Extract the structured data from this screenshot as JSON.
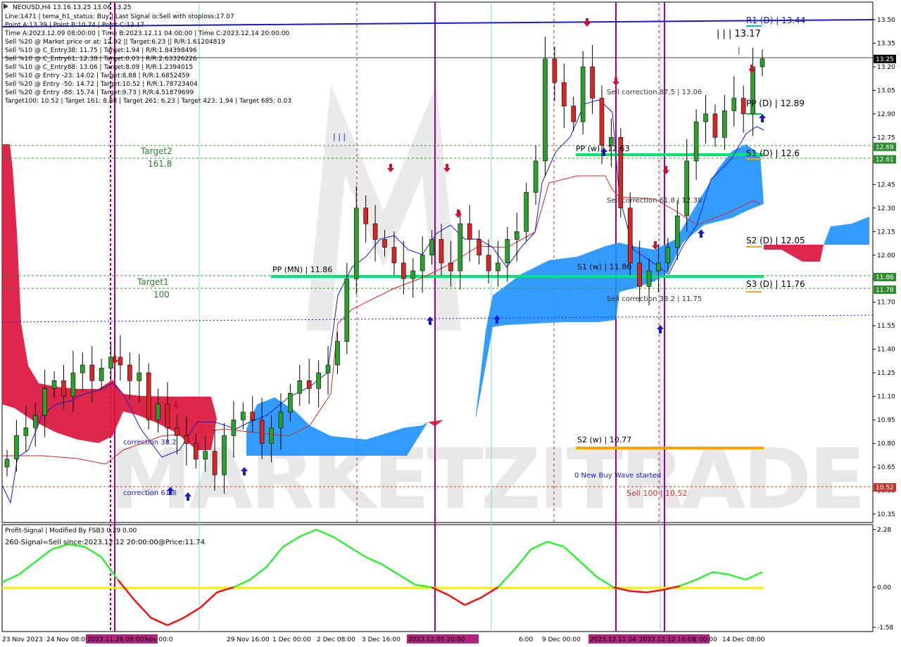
{
  "symbol": "NEOUSD,H4  13.16 13.25 13.06 13.25",
  "info_lines": [
    "Line:1471 | tema_h1_status: Buy | Last Signal is:Sell with stoploss:17.07",
    "Point A:13.39 | Point B:10.74 | Point C:12.17",
    "Time A:2023.12.09 08:00:00 | Time B:2023.12.11 04:00:00 | Time C:2023.12.14 20:00:00",
    "Sell %20 @ Market price or at: 12.92 || Target:6.23 || R/R:1.61204819",
    "Sell %10 @ C_Entry38: 11.75 | Target:1.94 | R/R:1.84398496",
    "Sell %10 @ C_Entry61: 12.38 | Target:0.03 | R/R:2.63326226",
    "Sell %10 @ C_Entry88: 13.06 | Target:8.09 | R/R:1.2394015",
    "Sell %10 @ Entry -23: 14.02 | Target:8.88 | R/R:1.6852459",
    "Sell %20 @ Entry -50: 14.72 | Target:10.52 | R/R:1.78723404",
    "Sell %20 @ Entry -88: 15.74 | Target:9.73 | R/R:4.51879699",
    "Target100: 10.52 | Target 161: 8.88 | Target 261: 6.23 | Target 423: 1.94 | Target 685: 0.03"
  ],
  "level_labels": {
    "r1_d": "R1 (D) | 13.44",
    "abc": "| | | 13.17",
    "pp_d": "PP (D) | 12.89",
    "s1_d": "S1 (D) | 12.6",
    "s2_d": "S2 (D) | 12.05",
    "s3_d": "S3 (D) | 11.76",
    "pp_w": "PP (w) | 12.63",
    "s1_w": "S1 (w) | 11.86",
    "s2_w": "S2 (w) | 10.77",
    "pp_mn": "PP (MN) | 11.86",
    "sell_corr_875": "Sell correction 87.5 | 13.06",
    "sell_corr_618": "Sell correction 61.8 | 12.38",
    "sell_corr_382": "Sell correction 38.2 | 11.75",
    "target2": "Target2",
    "target2_val": "161.8",
    "target1": "Target1",
    "target1_val": "100",
    "new_buy_wave": "0 New Buy Wave started",
    "sell_100": "Sell 100 | 10.52",
    "correction_382": "correction 38.2",
    "correction_618": "correction 61.8",
    "bars3_a": "| | |",
    "bars_b": "|",
    "bars_c": "| |"
  },
  "price_axis": {
    "ticks": [
      "13.50",
      "13.35",
      "13.20",
      "13.05",
      "12.90",
      "12.75",
      "12.60",
      "12.45",
      "12.30",
      "12.15",
      "12.00",
      "11.85",
      "11.70",
      "11.55",
      "11.40",
      "11.25",
      "11.10",
      "10.95",
      "10.80",
      "10.65",
      "10.50",
      "10.35"
    ],
    "badges": [
      {
        "text": "13.25",
        "bg": "#000000",
        "fg": "#ffffff"
      },
      {
        "text": "12.69",
        "bg": "#2e8b2e",
        "fg": "#ffffff"
      },
      {
        "text": "12.61",
        "bg": "#2e8b2e",
        "fg": "#ffffff"
      },
      {
        "text": "11.86",
        "bg": "#2e8b2e",
        "fg": "#ffffff"
      },
      {
        "text": "11.78",
        "bg": "#2e8b2e",
        "fg": "#ffffff"
      },
      {
        "text": "10.52",
        "bg": "#c0392b",
        "fg": "#ffffff"
      }
    ]
  },
  "time_axis": {
    "labels": [
      "23 Nov 2023",
      "24 Nov 08:00",
      "2023.11.26 08:00",
      "Nov 00:0",
      "29 Nov 16:00",
      "1 Dec 00:00",
      "2 Dec 08:00",
      "3 Dec 16:00",
      "2023.12.05 20:00",
      "6:00",
      "9 Dec 00:00",
      "2023.12.11 04",
      "2023.12.12 16:00",
      "c 00:00",
      "14 Dec 08:00"
    ],
    "highlighted": [
      "2023.11.26 08:00",
      "2023.12.05 20:00",
      "2023.12.11 04",
      "2023.12.12 16:00"
    ]
  },
  "indicator": {
    "title": "Profit-Signal | Modified By FSB3 0.29 0.00",
    "signal": "260-Signal=Sell since:2023.12.12 20:00:00@Price:11.74",
    "axis_ticks": [
      "2.28",
      "0.00",
      "-1.58"
    ]
  },
  "watermark": "MARKETZITRADE",
  "colors": {
    "bull": "#2ca02c",
    "bear": "#d62728",
    "cloud_bull": "#1e90ff",
    "cloud_bear": "#dc143c",
    "pivot": "#00e676",
    "s2w": "#ffa500",
    "r1": "#0000cc",
    "vline_magenta": "#a0008c",
    "vline_cyan": "#7fd4e0"
  },
  "chart_data": [
    {
      "type": "candlestick",
      "title": "NEOUSD,H4",
      "ylim": [
        10.31,
        13.54
      ],
      "last_ohlc": {
        "open": 13.16,
        "high": 13.25,
        "low": 13.06,
        "close": 13.25
      },
      "horizontal_levels": [
        {
          "name": "R1 (D)",
          "value": 13.44
        },
        {
          "name": "PP (D)",
          "value": 12.89
        },
        {
          "name": "S1 (D)",
          "value": 12.6
        },
        {
          "name": "S2 (D)",
          "value": 12.05
        },
        {
          "name": "S3 (D)",
          "value": 11.76
        },
        {
          "name": "PP (w)",
          "value": 12.63
        },
        {
          "name": "S1 (w)",
          "value": 11.86
        },
        {
          "name": "S2 (w)",
          "value": 10.77
        },
        {
          "name": "PP (MN)",
          "value": 11.86
        },
        {
          "name": "Target2",
          "value": 12.61
        },
        {
          "name": "Target1",
          "value": 11.78
        },
        {
          "name": "Sell 100",
          "value": 10.52
        }
      ],
      "candles_close": [
        10.7,
        10.85,
        10.9,
        10.98,
        11.15,
        11.2,
        11.1,
        11.25,
        11.3,
        11.2,
        11.28,
        11.35,
        11.3,
        11.2,
        11.25,
        10.95,
        11.05,
        10.9,
        10.85,
        10.8,
        10.7,
        10.75,
        10.6,
        10.85,
        10.95,
        11.0,
        10.95,
        10.8,
        10.9,
        11.0,
        11.12,
        11.2,
        11.15,
        11.25,
        11.3,
        11.45,
        11.85,
        12.3,
        12.2,
        12.1,
        12.05,
        11.95,
        11.85,
        11.9,
        12.0,
        12.1,
        11.95,
        11.9,
        12.2,
        12.1,
        12.0,
        11.9,
        11.95,
        12.1,
        12.15,
        12.4,
        12.6,
        13.25,
        13.1,
        12.95,
        12.85,
        13.2,
        13.0,
        12.7,
        12.75,
        12.3,
        11.95,
        11.8,
        11.9,
        11.95,
        12.05,
        12.25,
        12.6,
        12.85,
        12.9,
        12.75,
        12.92,
        13.0,
        12.9,
        13.2,
        13.25
      ]
    },
    {
      "type": "line",
      "title": "Profit-Signal | Modified By FSB3 0.29 0.00",
      "ylim": [
        -1.58,
        2.28
      ],
      "series": [
        {
          "values": [
            0.2,
            0.5,
            1.0,
            1.5,
            1.7,
            1.6,
            1.2,
            0.3,
            -0.5,
            -1.2,
            -1.5,
            -1.2,
            -0.8,
            -0.2,
            0.0,
            0.3,
            0.8,
            1.6,
            2.0,
            2.28,
            2.0,
            1.6,
            1.2,
            0.9,
            0.5,
            0.1,
            0.0,
            -0.3,
            -0.7,
            -0.4,
            0.0,
            0.7,
            1.5,
            1.8,
            1.6,
            1.0,
            0.4,
            0.0,
            -0.15,
            -0.2,
            -0.1,
            0.05,
            0.3,
            0.6,
            0.5,
            0.3,
            0.6
          ]
        }
      ]
    }
  ]
}
